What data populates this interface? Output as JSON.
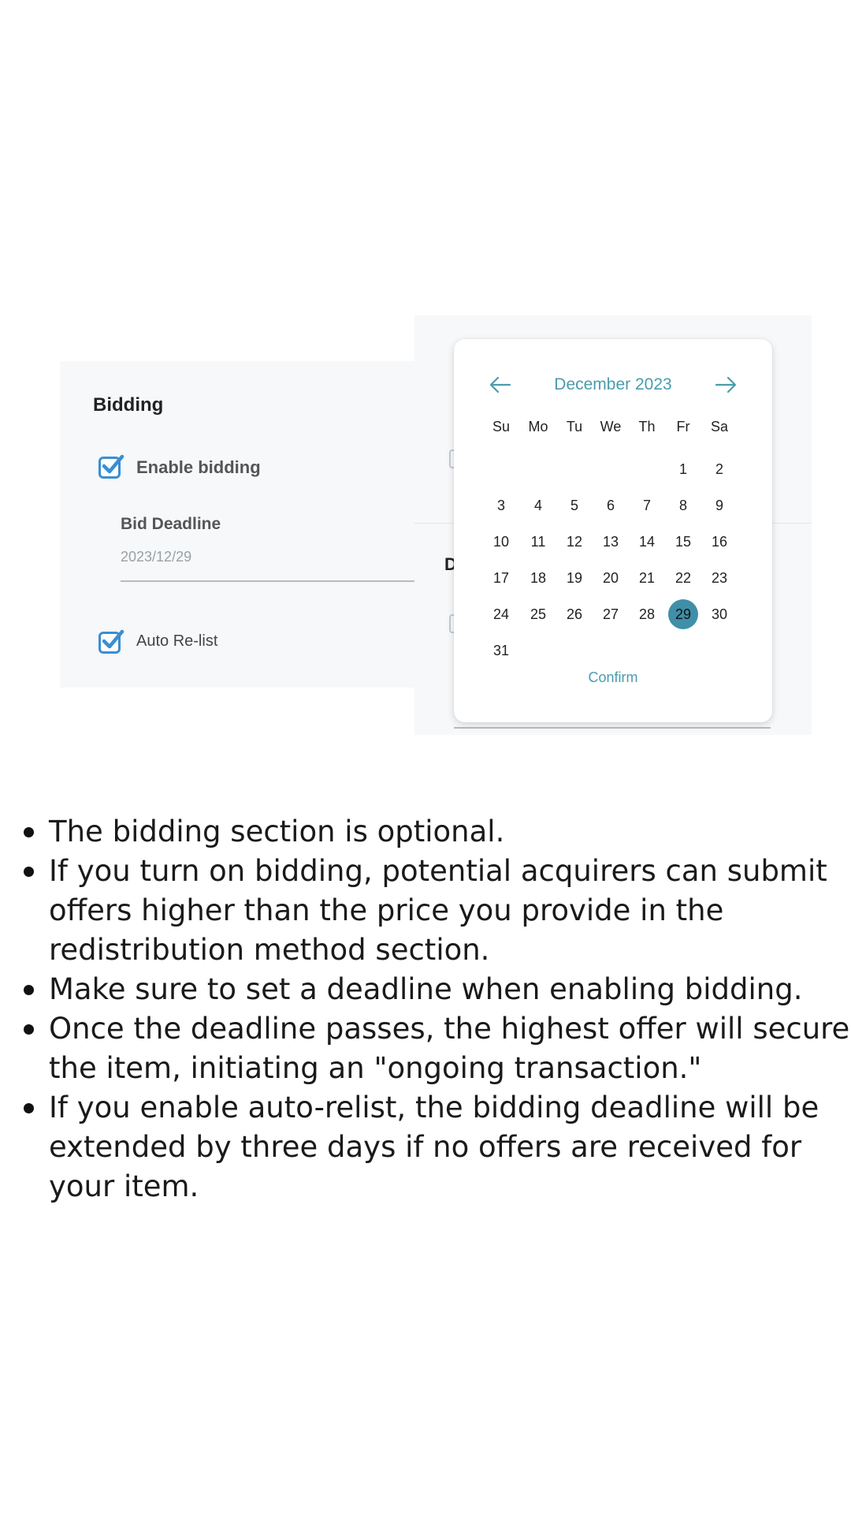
{
  "bidding": {
    "title": "Bidding",
    "enable_label": "Enable bidding",
    "enable_checked": true,
    "deadline_label": "Bid Deadline",
    "deadline_value": "2023/12/29",
    "relist_label": "Auto Re-list",
    "relist_checked": true
  },
  "obscured_panel": {
    "partial_heading": "D"
  },
  "date_picker": {
    "month_title": "December 2023",
    "prev_icon": "arrow-left-icon",
    "next_icon": "arrow-right-icon",
    "weekdays": [
      "Su",
      "Mo",
      "Tu",
      "We",
      "Th",
      "Fr",
      "Sa"
    ],
    "weeks": [
      [
        "",
        "",
        "",
        "",
        "",
        "1",
        "2"
      ],
      [
        "3",
        "4",
        "5",
        "6",
        "7",
        "8",
        "9"
      ],
      [
        "10",
        "11",
        "12",
        "13",
        "14",
        "15",
        "16"
      ],
      [
        "17",
        "18",
        "19",
        "20",
        "21",
        "22",
        "23"
      ],
      [
        "24",
        "25",
        "26",
        "27",
        "28",
        "29",
        "30"
      ],
      [
        "31",
        "",
        "",
        "",
        "",
        "",
        ""
      ]
    ],
    "selected_day": "29",
    "confirm_label": "Confirm",
    "accent_color": "#4a9cae",
    "selected_color": "#3f8fa8"
  },
  "notes": [
    "The bidding section is optional.",
    "If you turn on bidding, potential acquirers can submit offers higher than the price you provide in the redistribution method section.",
    "Make sure to set a deadline when enabling bidding.",
    "Once the deadline passes, the highest offer will secure the item, initiating an \"ongoing transaction.\"",
    "If you enable auto-relist, the bidding deadline will be extended by three days if no offers are received for your item."
  ]
}
